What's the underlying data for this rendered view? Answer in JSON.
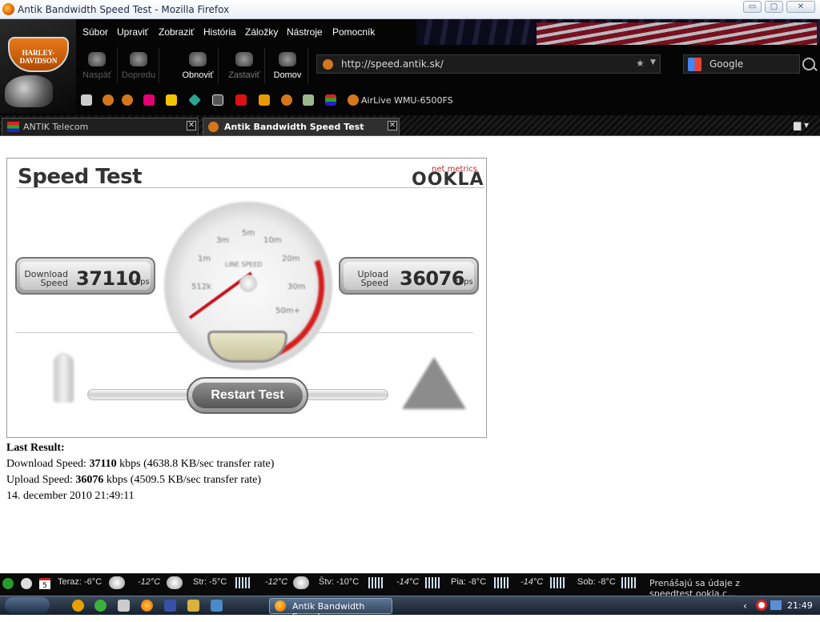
{
  "window": {
    "title": "Antik Bandwidth Speed Test - Mozilla Firefox",
    "minimize": "▭",
    "maximize": "▢",
    "close": "✕"
  },
  "menu": [
    "Súbor",
    "Upraviť",
    "Zobraziť",
    "História",
    "Záložky",
    "Nástroje",
    "Pomocník"
  ],
  "nav": {
    "back": "Naspäť",
    "forward": "Dopredu",
    "reload": "Obnoviť",
    "stop": "Zastaviť",
    "home": "Domov"
  },
  "urlbar": {
    "url": "http://speed.antik.sk/"
  },
  "search": {
    "engine": "Google"
  },
  "bookmarks": {
    "airlive": "AirLive WMU-6500FS"
  },
  "tabs": [
    {
      "label": "ANTIK Telecom"
    },
    {
      "label": "Antik Bandwidth Speed Test"
    }
  ],
  "speedtest": {
    "title": "Speed Test",
    "brand_small": "net metrics",
    "brand": "OOKLA",
    "gauge_ticks": [
      "512k",
      "1m",
      "3m",
      "5m",
      "10m",
      "20m",
      "30m",
      "50m+"
    ],
    "gauge_label": "LINE SPEED",
    "download": {
      "label1": "Download",
      "label2": "Speed",
      "value": "37110",
      "unit": "kbps"
    },
    "upload": {
      "label1": "Upload",
      "label2": "Speed",
      "value": "36076",
      "unit": "kbps"
    },
    "restart_label": "Restart Test"
  },
  "result": {
    "heading": "Last Result:",
    "download_prefix": "Download Speed: ",
    "download_value": "37110",
    "download_suffix": " kbps (4638.8 KB/sec transfer rate)",
    "upload_prefix": "Upload Speed: ",
    "upload_value": "36076",
    "upload_suffix": " kbps (4509.5 KB/sec transfer rate)",
    "timestamp": "14. december 2010 21:49:11"
  },
  "weather": [
    "Teraz: -6°C",
    "-12°C",
    "Str: -5°C",
    "-12°C",
    "Štv: -10°C",
    "-14°C",
    "Pia: -8°C",
    "-14°C",
    "Sob: -8°C"
  ],
  "calendar_day": "5",
  "status": {
    "message": "Prenášajú sa údaje z speedtest.ookla.c..."
  },
  "taskbar": {
    "window_label": "Antik Bandwidth Speed...",
    "clock": "21:49",
    "tray_arrow": "‹"
  },
  "logo": {
    "text": "HARLEY-DAVIDSON"
  }
}
